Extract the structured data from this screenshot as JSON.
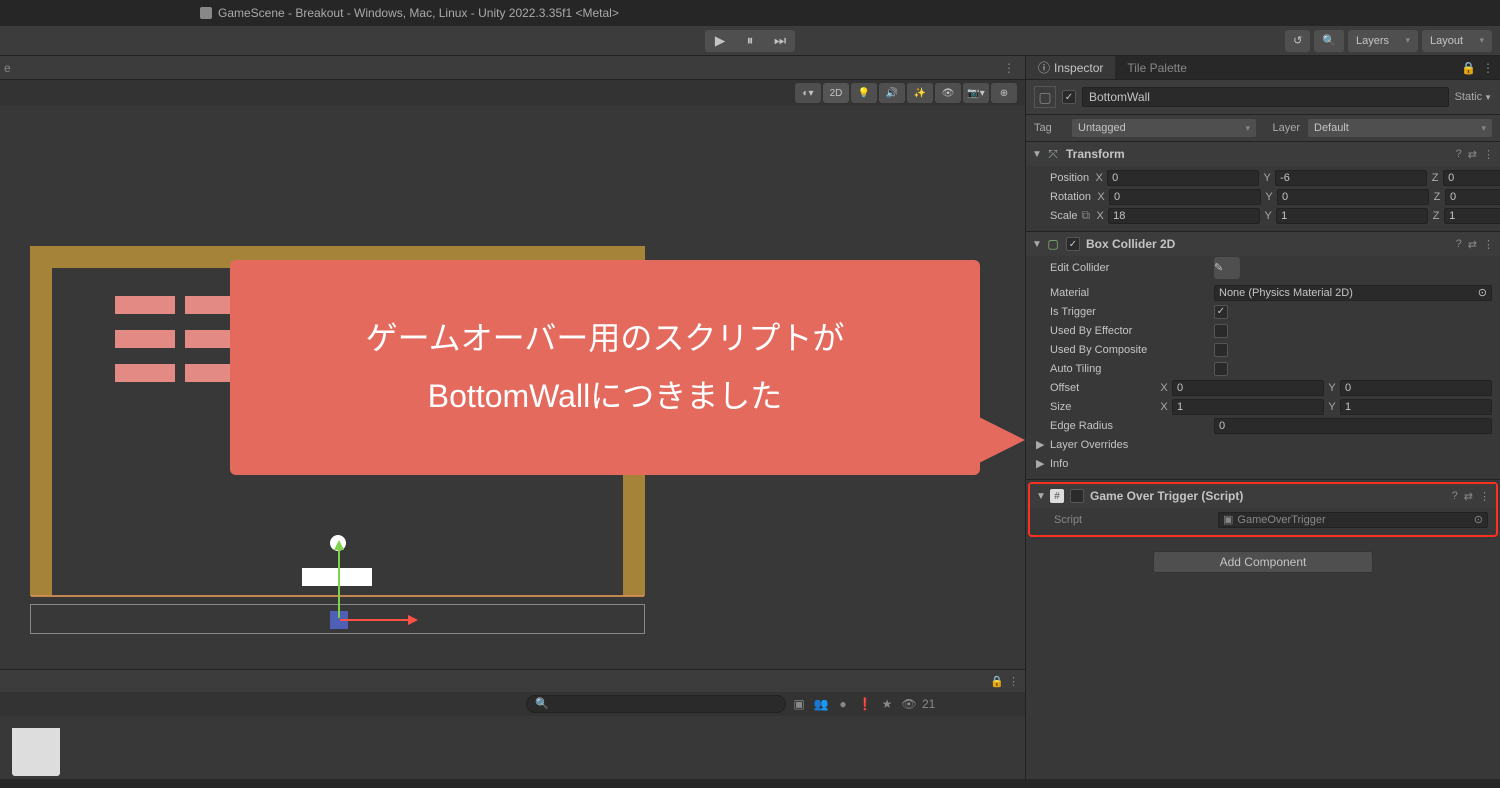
{
  "titlebar": {
    "text": "GameScene - Breakout - Windows, Mac, Linux - Unity 2022.3.35f1 <Metal>"
  },
  "top_toolbar": {
    "layers_label": "Layers",
    "layout_label": "Layout"
  },
  "scene_toolbar": {
    "d2": "2D"
  },
  "inspector": {
    "tab_inspector": "Inspector",
    "tab_tilepalette": "Tile Palette",
    "object_name": "BottomWall",
    "static_label": "Static",
    "tag_label": "Tag",
    "tag_value": "Untagged",
    "layer_label": "Layer",
    "layer_value": "Default"
  },
  "transform": {
    "title": "Transform",
    "position_label": "Position",
    "rotation_label": "Rotation",
    "scale_label": "Scale",
    "pos": {
      "x": "0",
      "y": "-6",
      "z": "0"
    },
    "rot": {
      "x": "0",
      "y": "0",
      "z": "0"
    },
    "scale": {
      "x": "18",
      "y": "1",
      "z": "1"
    }
  },
  "boxcollider": {
    "title": "Box Collider 2D",
    "edit_collider": "Edit Collider",
    "material": "Material",
    "material_value": "None (Physics Material 2D)",
    "is_trigger": "Is Trigger",
    "used_by_effector": "Used By Effector",
    "used_by_composite": "Used By Composite",
    "auto_tiling": "Auto Tiling",
    "offset": "Offset",
    "offset_x": "0",
    "offset_y": "0",
    "size": "Size",
    "size_x": "1",
    "size_y": "1",
    "edge_radius": "Edge Radius",
    "edge_radius_value": "0",
    "layer_overrides": "Layer Overrides",
    "info": "Info"
  },
  "gameovertrigger": {
    "title": "Game Over Trigger (Script)",
    "script_label": "Script",
    "script_value": "GameOverTrigger"
  },
  "add_component": "Add Component",
  "callout": {
    "line1": "ゲームオーバー用のスクリプトが",
    "line2": "BottomWallにつきました"
  },
  "lower": {
    "hidden_count": "21"
  }
}
